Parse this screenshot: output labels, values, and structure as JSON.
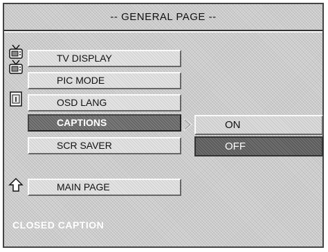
{
  "header": {
    "title": "-- GENERAL PAGE --"
  },
  "menu": {
    "items": [
      {
        "label": "TV DISPLAY",
        "icon": "tv-icon"
      },
      {
        "label": "PIC MODE",
        "icon": "tv-icon"
      },
      {
        "label": "OSD LANG",
        "icon": "document-icon"
      },
      {
        "label": "CAPTIONS",
        "icon": ""
      },
      {
        "label": "SCR SAVER",
        "icon": ""
      }
    ],
    "selected_index": 3,
    "main_page": {
      "label": "MAIN PAGE",
      "icon": "up-arrow-icon"
    }
  },
  "submenu": {
    "options": [
      "ON",
      "OFF"
    ],
    "selected": "OFF"
  },
  "status_bar": {
    "text": "CLOSED CAPTION"
  }
}
